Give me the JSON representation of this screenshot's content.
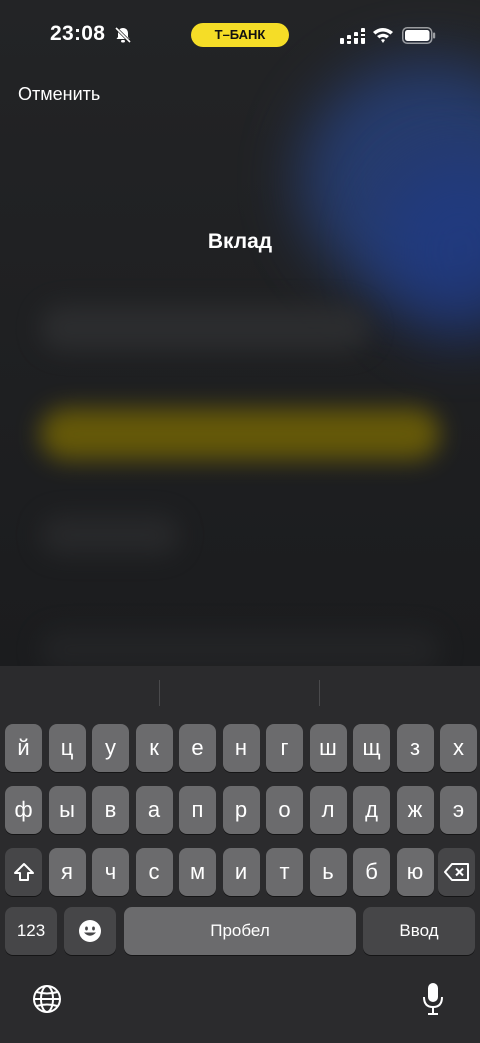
{
  "status_bar": {
    "time": "23:08",
    "carrier_badge": "Т–БАНК",
    "icons": [
      "bell-slash-icon",
      "signal-icon",
      "wifi-icon",
      "battery-icon"
    ],
    "badge_color": "#f5dd27"
  },
  "header": {
    "cancel_label": "Отменить",
    "title": "Вклад"
  },
  "keyboard": {
    "row1": [
      "й",
      "ц",
      "у",
      "к",
      "е",
      "н",
      "г",
      "ш",
      "щ",
      "з",
      "х"
    ],
    "row2": [
      "ф",
      "ы",
      "в",
      "а",
      "п",
      "р",
      "о",
      "л",
      "д",
      "ж",
      "э"
    ],
    "row3": [
      "я",
      "ч",
      "с",
      "м",
      "и",
      "т",
      "ь",
      "б",
      "ю"
    ],
    "numbers_label": "123",
    "space_label": "Пробел",
    "enter_label": "Ввод",
    "icons": [
      "shift-icon",
      "backspace-icon",
      "emoji-icon",
      "globe-icon",
      "microphone-icon"
    ]
  }
}
